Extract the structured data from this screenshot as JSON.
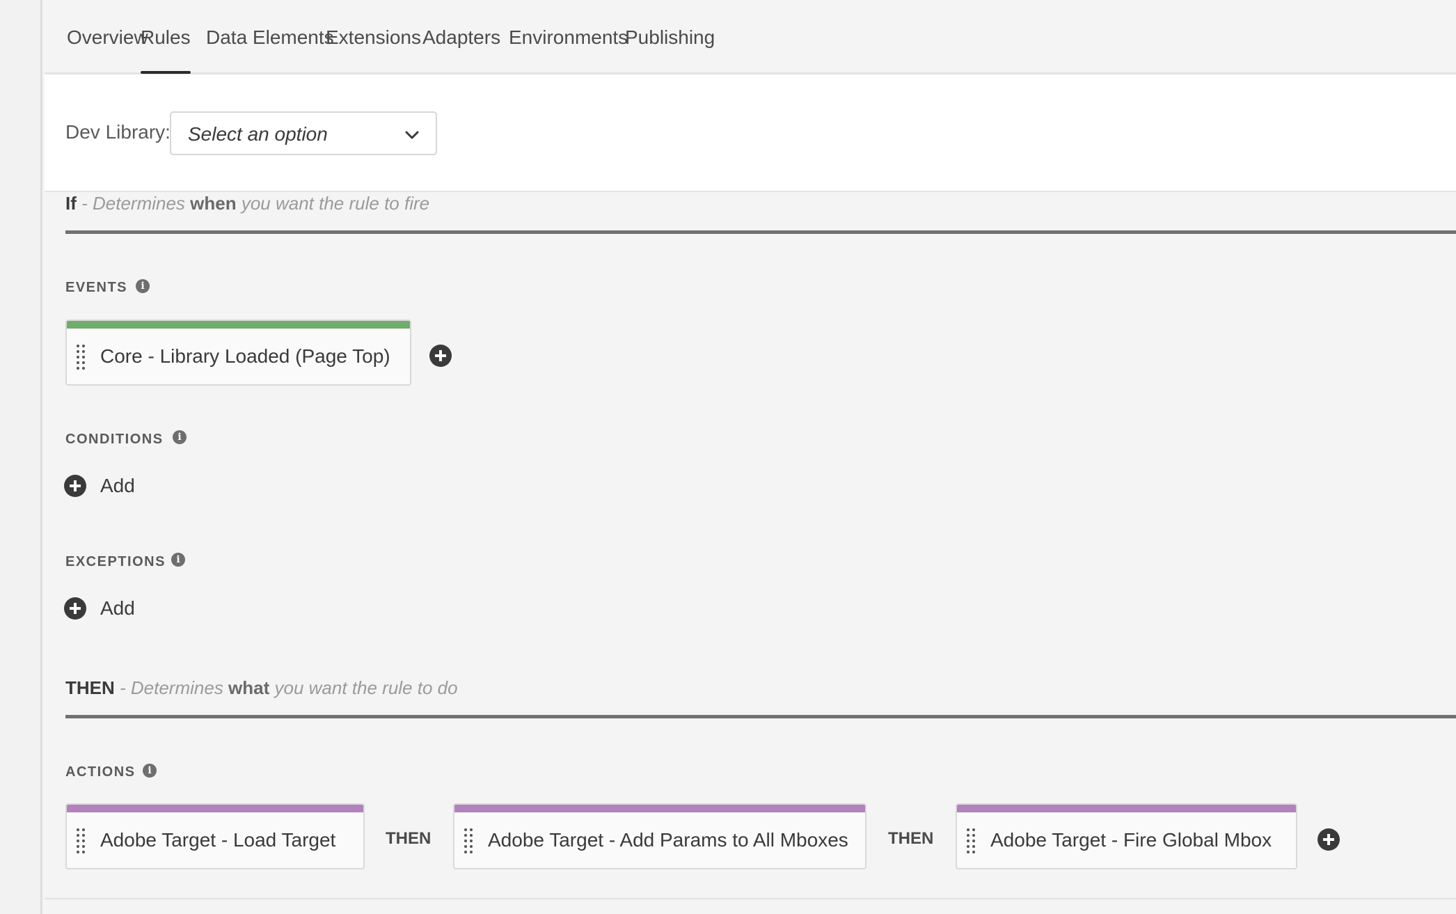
{
  "tabs": [
    {
      "label": "Overview"
    },
    {
      "label": "Rules"
    },
    {
      "label": "Data Elements"
    },
    {
      "label": "Extensions"
    },
    {
      "label": "Adapters"
    },
    {
      "label": "Environments"
    },
    {
      "label": "Publishing"
    }
  ],
  "active_tab": "Rules",
  "dev_library": {
    "label": "Dev Library:",
    "selected": "Select an option"
  },
  "if_section": {
    "keyword": "If",
    "pre": " - Determines ",
    "emphasis": "when",
    "post": " you want the rule to fire"
  },
  "events": {
    "label": "EVENTS",
    "items": [
      {
        "text": "Core - Library Loaded (Page Top)"
      }
    ]
  },
  "conditions": {
    "label": "CONDITIONS",
    "add_label": "Add"
  },
  "exceptions": {
    "label": "EXCEPTIONS",
    "add_label": "Add"
  },
  "then_section": {
    "keyword": "THEN",
    "pre": " - Determines ",
    "emphasis": "what",
    "post": " you want the rule to do"
  },
  "actions": {
    "label": "ACTIONS",
    "separator": "THEN",
    "items": [
      {
        "text": "Adobe Target - Load Target"
      },
      {
        "text": "Adobe Target - Add Params to All Mboxes"
      },
      {
        "text": "Adobe Target - Fire Global Mbox"
      }
    ]
  },
  "info_glyph": "i",
  "colors": {
    "event_bar": "#6fad6a",
    "action_bar": "#b282bd",
    "tab_underline": "#2c2c2c"
  }
}
